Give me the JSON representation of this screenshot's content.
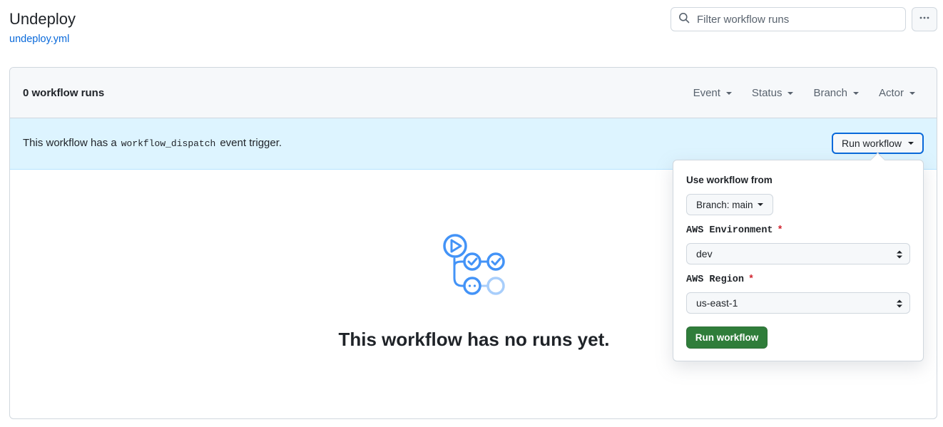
{
  "page": {
    "title": "Undeploy",
    "file_link": "undeploy.yml"
  },
  "search": {
    "placeholder": "Filter workflow runs",
    "value": ""
  },
  "toolbar": {
    "more_icon": "kebab-horizontal-icon"
  },
  "runs": {
    "count_label": "0 workflow runs",
    "filters": [
      {
        "label": "Event"
      },
      {
        "label": "Status"
      },
      {
        "label": "Branch"
      },
      {
        "label": "Actor"
      }
    ]
  },
  "dispatch": {
    "text_before": "This workflow has a",
    "code": "workflow_dispatch",
    "text_after": "event trigger.",
    "run_button_label": "Run workflow"
  },
  "empty_state": {
    "icon": "workflow-graph-icon",
    "message": "This workflow has no runs yet."
  },
  "run_form": {
    "source_label": "Use workflow from",
    "branch_button_label": "Branch: main",
    "fields": [
      {
        "label": "AWS Environment",
        "required_mark": "*",
        "value": "dev"
      },
      {
        "label": "AWS Region",
        "required_mark": "*",
        "value": "us-east-1"
      }
    ],
    "submit_label": "Run workflow"
  },
  "colors": {
    "link": "#0969da",
    "accent_blue": "#0969da",
    "dispatch_bg": "#ddf4ff",
    "success_button": "#2f7d3a",
    "required": "#d1242f",
    "icon_blue": "#4393f7",
    "icon_blue_light": "#a8cefb"
  }
}
